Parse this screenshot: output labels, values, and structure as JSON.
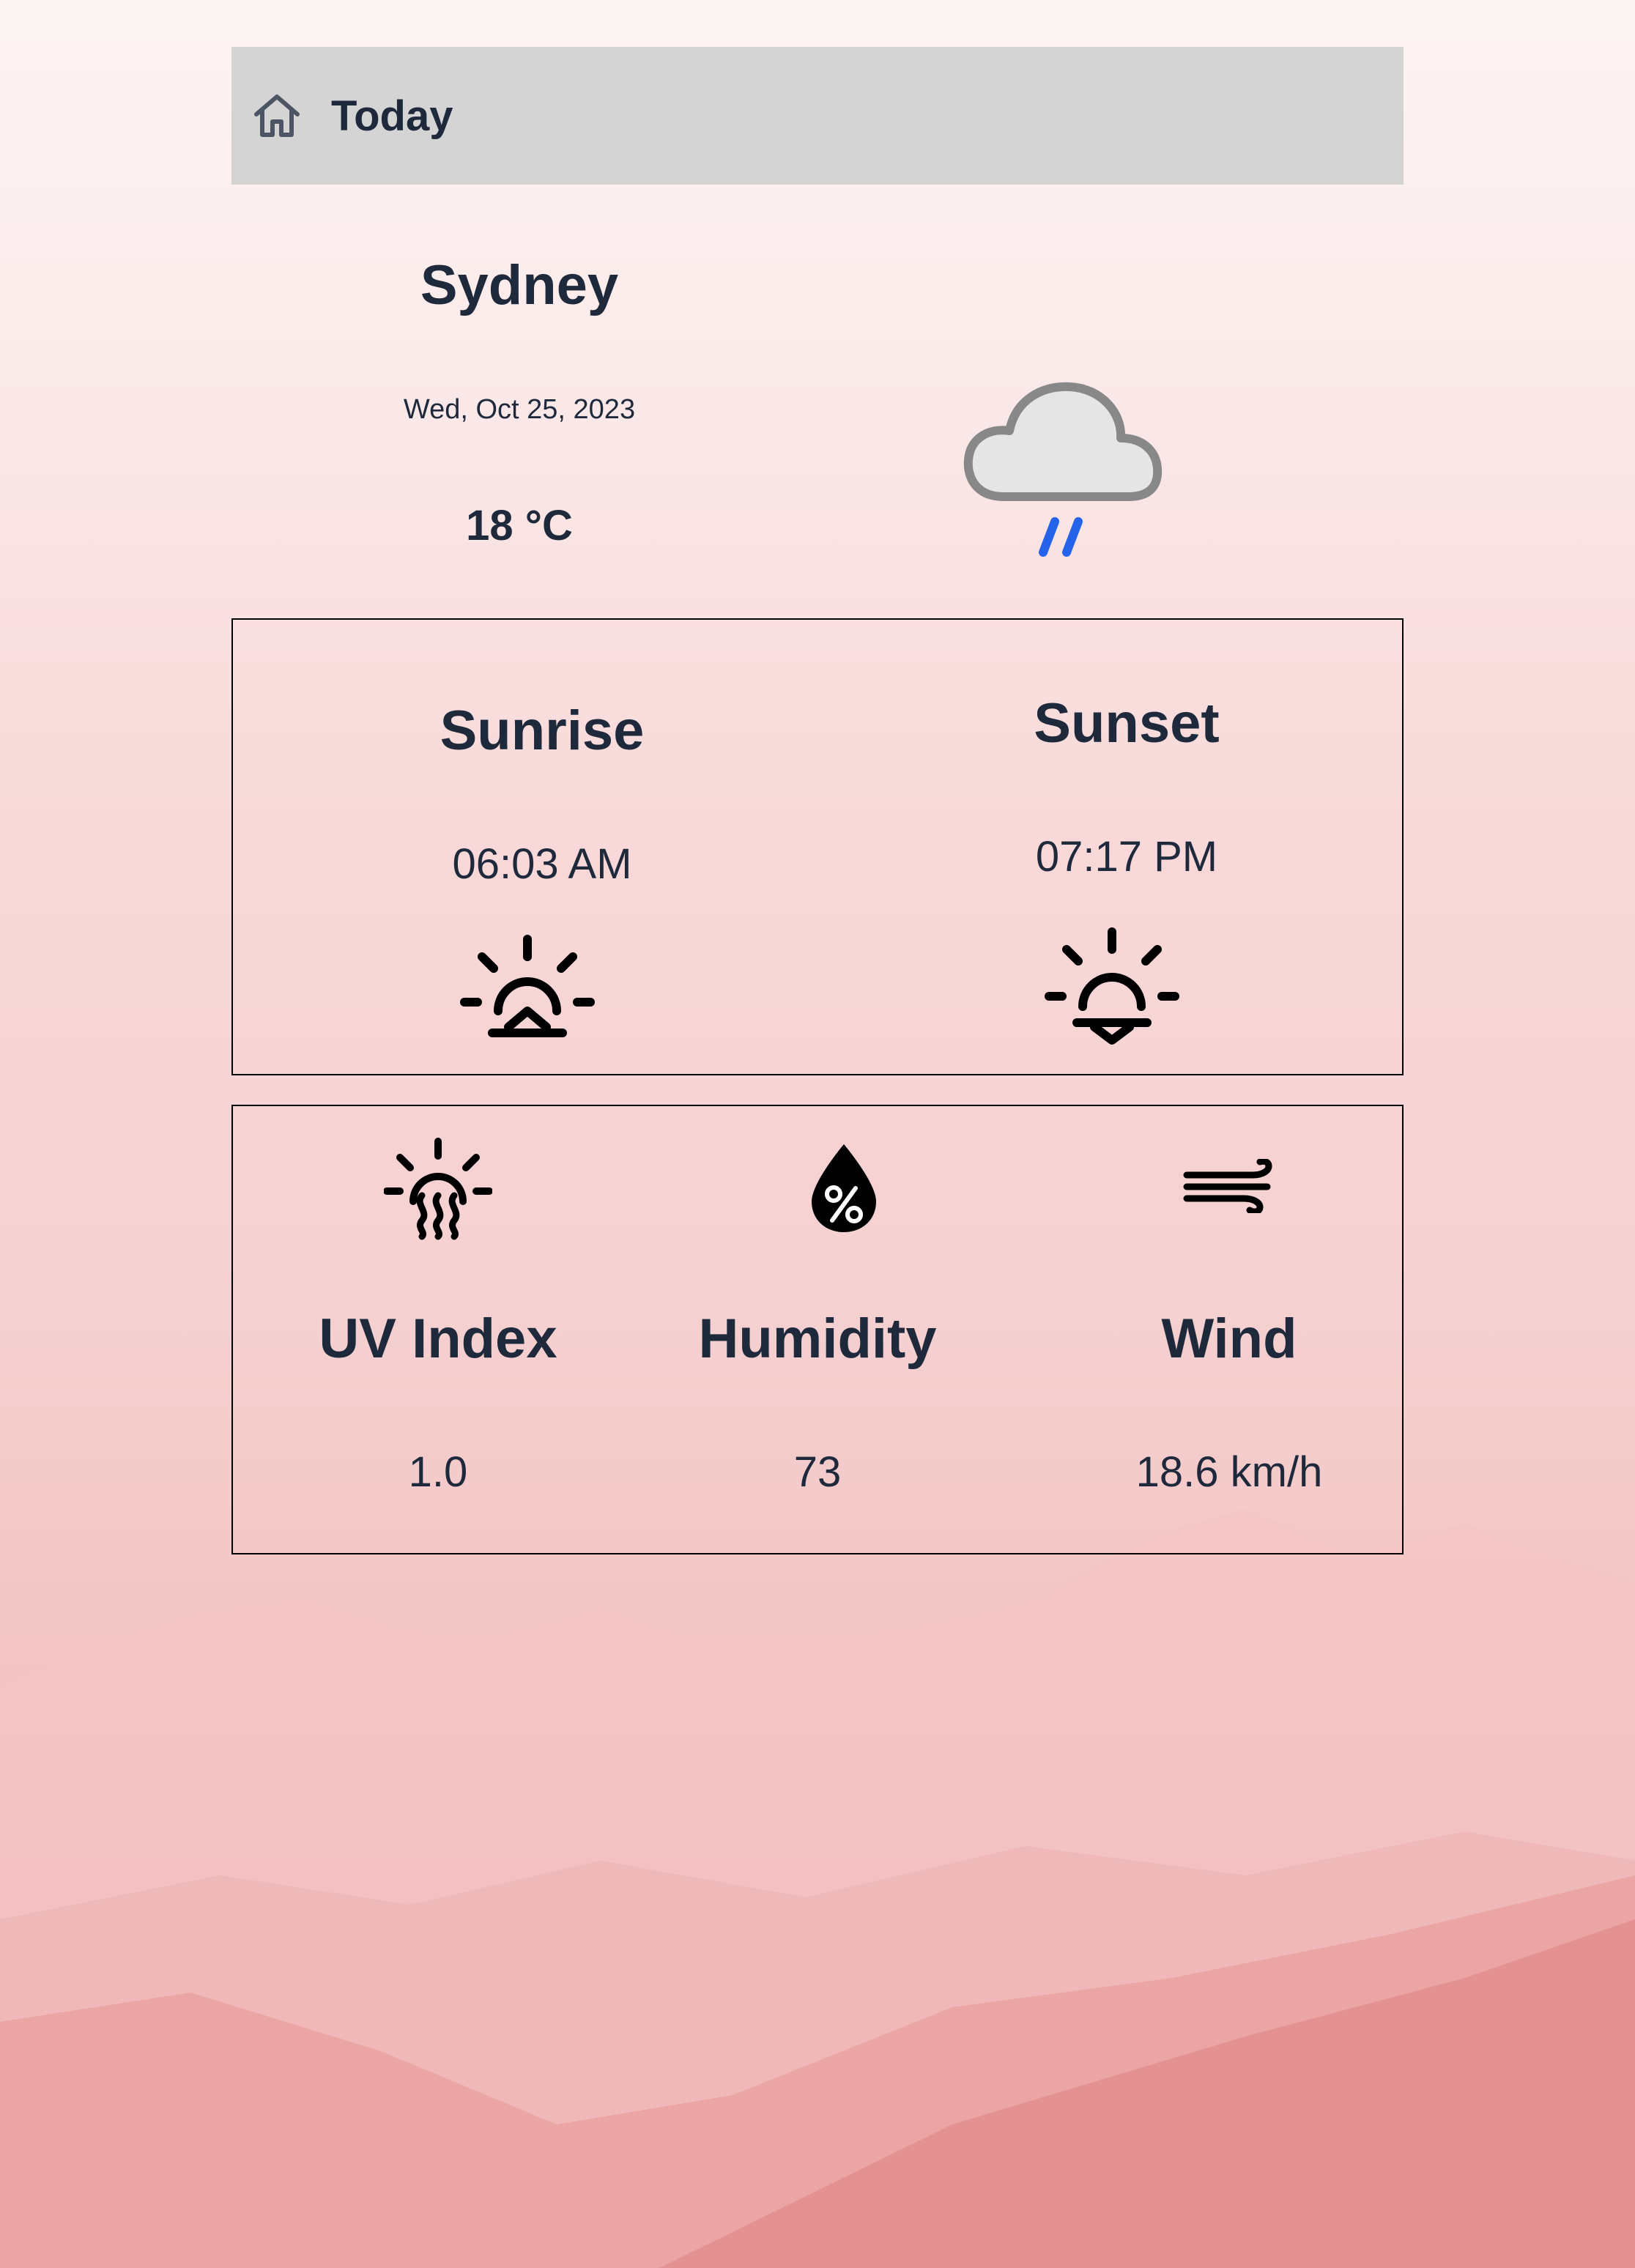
{
  "header": {
    "icon": "home-icon",
    "title": "Today"
  },
  "current": {
    "city": "Sydney",
    "date": "Wed, Oct 25, 2023",
    "temperature": "18 °C",
    "condition_icon": "cloud-rain-icon"
  },
  "sun": {
    "sunrise_label": "Sunrise",
    "sunrise_time": "06:03 AM",
    "sunrise_icon": "sunrise-icon",
    "sunset_label": "Sunset",
    "sunset_time": "07:17 PM",
    "sunset_icon": "sunset-icon"
  },
  "stats": {
    "uv_label": "UV Index",
    "uv_value": "1.0",
    "uv_icon": "sun-heat-icon",
    "humidity_label": "Humidity",
    "humidity_value": "73",
    "humidity_icon": "humidity-drop-icon",
    "wind_label": "Wind",
    "wind_value": "18.6 km/h",
    "wind_icon": "wind-icon"
  },
  "colors": {
    "topbar": "#d4d4d4",
    "text": "#1e293b",
    "rain": "#2563eb",
    "background_tint": "#f5cfcf"
  }
}
